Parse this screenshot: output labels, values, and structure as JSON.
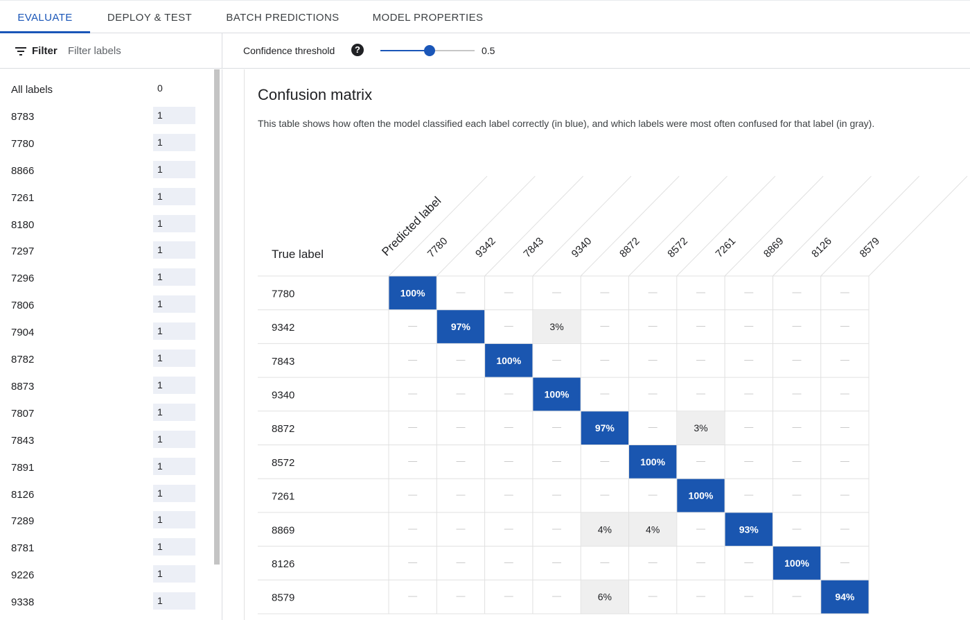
{
  "tabs": [
    "EVALUATE",
    "DEPLOY & TEST",
    "BATCH PREDICTIONS",
    "MODEL PROPERTIES"
  ],
  "filter": {
    "label": "Filter",
    "placeholder": "Filter labels",
    "value": ""
  },
  "labels": [
    {
      "name": "All labels",
      "count": "0"
    },
    {
      "name": "8783",
      "count": "1"
    },
    {
      "name": "7780",
      "count": "1"
    },
    {
      "name": "8866",
      "count": "1"
    },
    {
      "name": "7261",
      "count": "1"
    },
    {
      "name": "8180",
      "count": "1"
    },
    {
      "name": "7297",
      "count": "1"
    },
    {
      "name": "7296",
      "count": "1"
    },
    {
      "name": "7806",
      "count": "1"
    },
    {
      "name": "7904",
      "count": "1"
    },
    {
      "name": "8782",
      "count": "1"
    },
    {
      "name": "8873",
      "count": "1"
    },
    {
      "name": "7807",
      "count": "1"
    },
    {
      "name": "7843",
      "count": "1"
    },
    {
      "name": "7891",
      "count": "1"
    },
    {
      "name": "8126",
      "count": "1"
    },
    {
      "name": "7289",
      "count": "1"
    },
    {
      "name": "8781",
      "count": "1"
    },
    {
      "name": "9226",
      "count": "1"
    },
    {
      "name": "9338",
      "count": "1"
    }
  ],
  "threshold": {
    "label": "Confidence threshold",
    "value": 0.5,
    "value_text": "0.5",
    "help_icon": "help-circle-icon"
  },
  "main": {
    "title": "Confusion matrix",
    "description": "This table shows how often the model classified each label correctly (in blue), and which labels were most often confused for that label (in gray)."
  },
  "chart_data": {
    "type": "heatmap",
    "predicted_axis_label": "Predicted label",
    "true_axis_label": "True label",
    "columns": [
      "7780",
      "9342",
      "7843",
      "9340",
      "8872",
      "8572",
      "7261",
      "8869",
      "8126",
      "8579"
    ],
    "rows": [
      "7780",
      "9342",
      "7843",
      "9340",
      "8872",
      "8572",
      "7261",
      "8869",
      "8126",
      "8579"
    ],
    "values": [
      [
        100,
        null,
        null,
        null,
        null,
        null,
        null,
        null,
        null,
        null
      ],
      [
        null,
        97,
        null,
        3,
        null,
        null,
        null,
        null,
        null,
        null
      ],
      [
        null,
        null,
        100,
        null,
        null,
        null,
        null,
        null,
        null,
        null
      ],
      [
        null,
        null,
        null,
        100,
        null,
        null,
        null,
        null,
        null,
        null
      ],
      [
        null,
        null,
        null,
        null,
        97,
        null,
        3,
        null,
        null,
        null
      ],
      [
        null,
        null,
        null,
        null,
        null,
        100,
        null,
        null,
        null,
        null
      ],
      [
        null,
        null,
        null,
        null,
        null,
        null,
        100,
        null,
        null,
        null
      ],
      [
        null,
        null,
        null,
        null,
        4,
        4,
        null,
        93,
        null,
        null
      ],
      [
        null,
        null,
        null,
        null,
        null,
        null,
        null,
        null,
        100,
        null
      ],
      [
        null,
        null,
        null,
        null,
        6,
        null,
        null,
        null,
        null,
        94
      ]
    ],
    "empty_symbol": "—",
    "unit": "%",
    "colors": {
      "correct": "#1a56b0",
      "confused": "#efefef",
      "grid": "#e0e0e0"
    }
  }
}
